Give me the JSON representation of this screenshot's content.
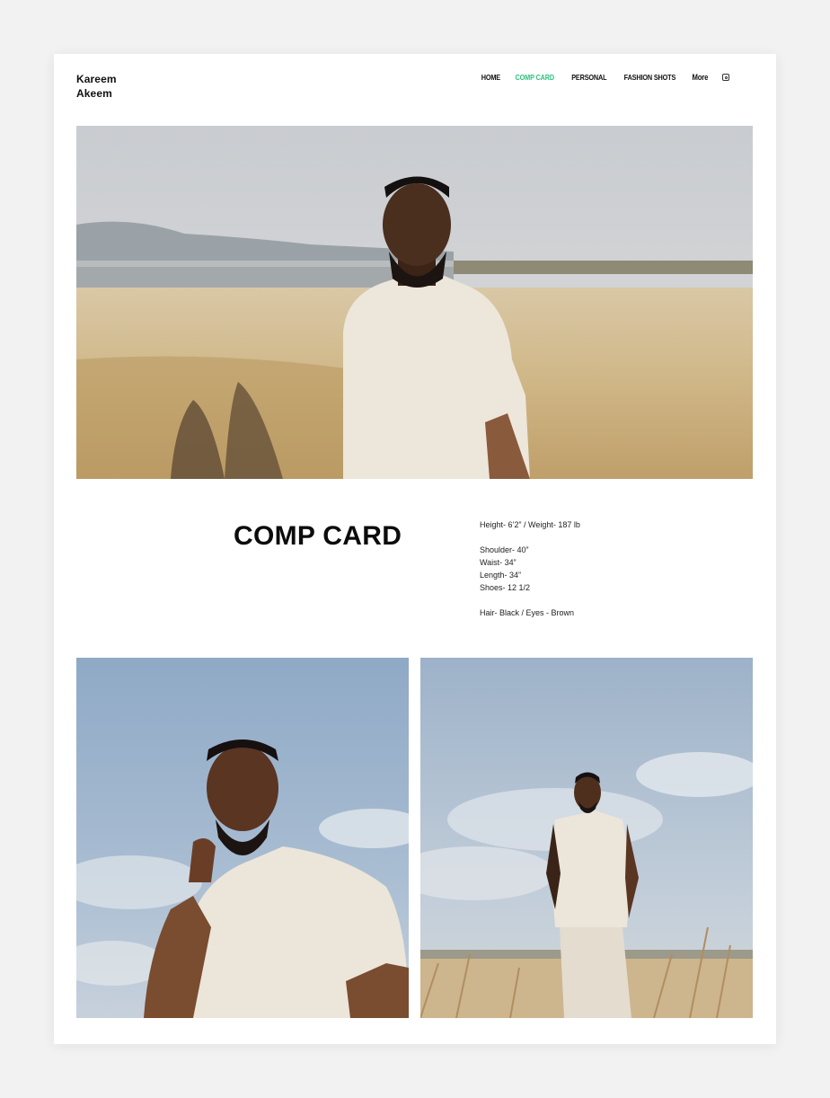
{
  "brand": {
    "line1": "Kareem",
    "line2": "Akeem"
  },
  "nav": {
    "items": [
      {
        "label": "HOME",
        "active": false
      },
      {
        "label": "COMP CARD",
        "active": true
      },
      {
        "label": "PERSONAL",
        "active": false
      },
      {
        "label": "FASHION SHOTS",
        "active": false
      }
    ],
    "more_label": "More",
    "social_icon": "instagram-icon",
    "active_color": "#2ec27e"
  },
  "comp_card": {
    "title": "COMP CARD",
    "height_weight": "Height- 6’2” / Weight- 187 lb",
    "shoulder": "Shoulder- 40”",
    "waist": "Waist- 34”",
    "length": "Length- 34”",
    "shoes": "Shoes- 12 1/2",
    "hair_eyes": "Hair- Black / Eyes - Brown"
  }
}
